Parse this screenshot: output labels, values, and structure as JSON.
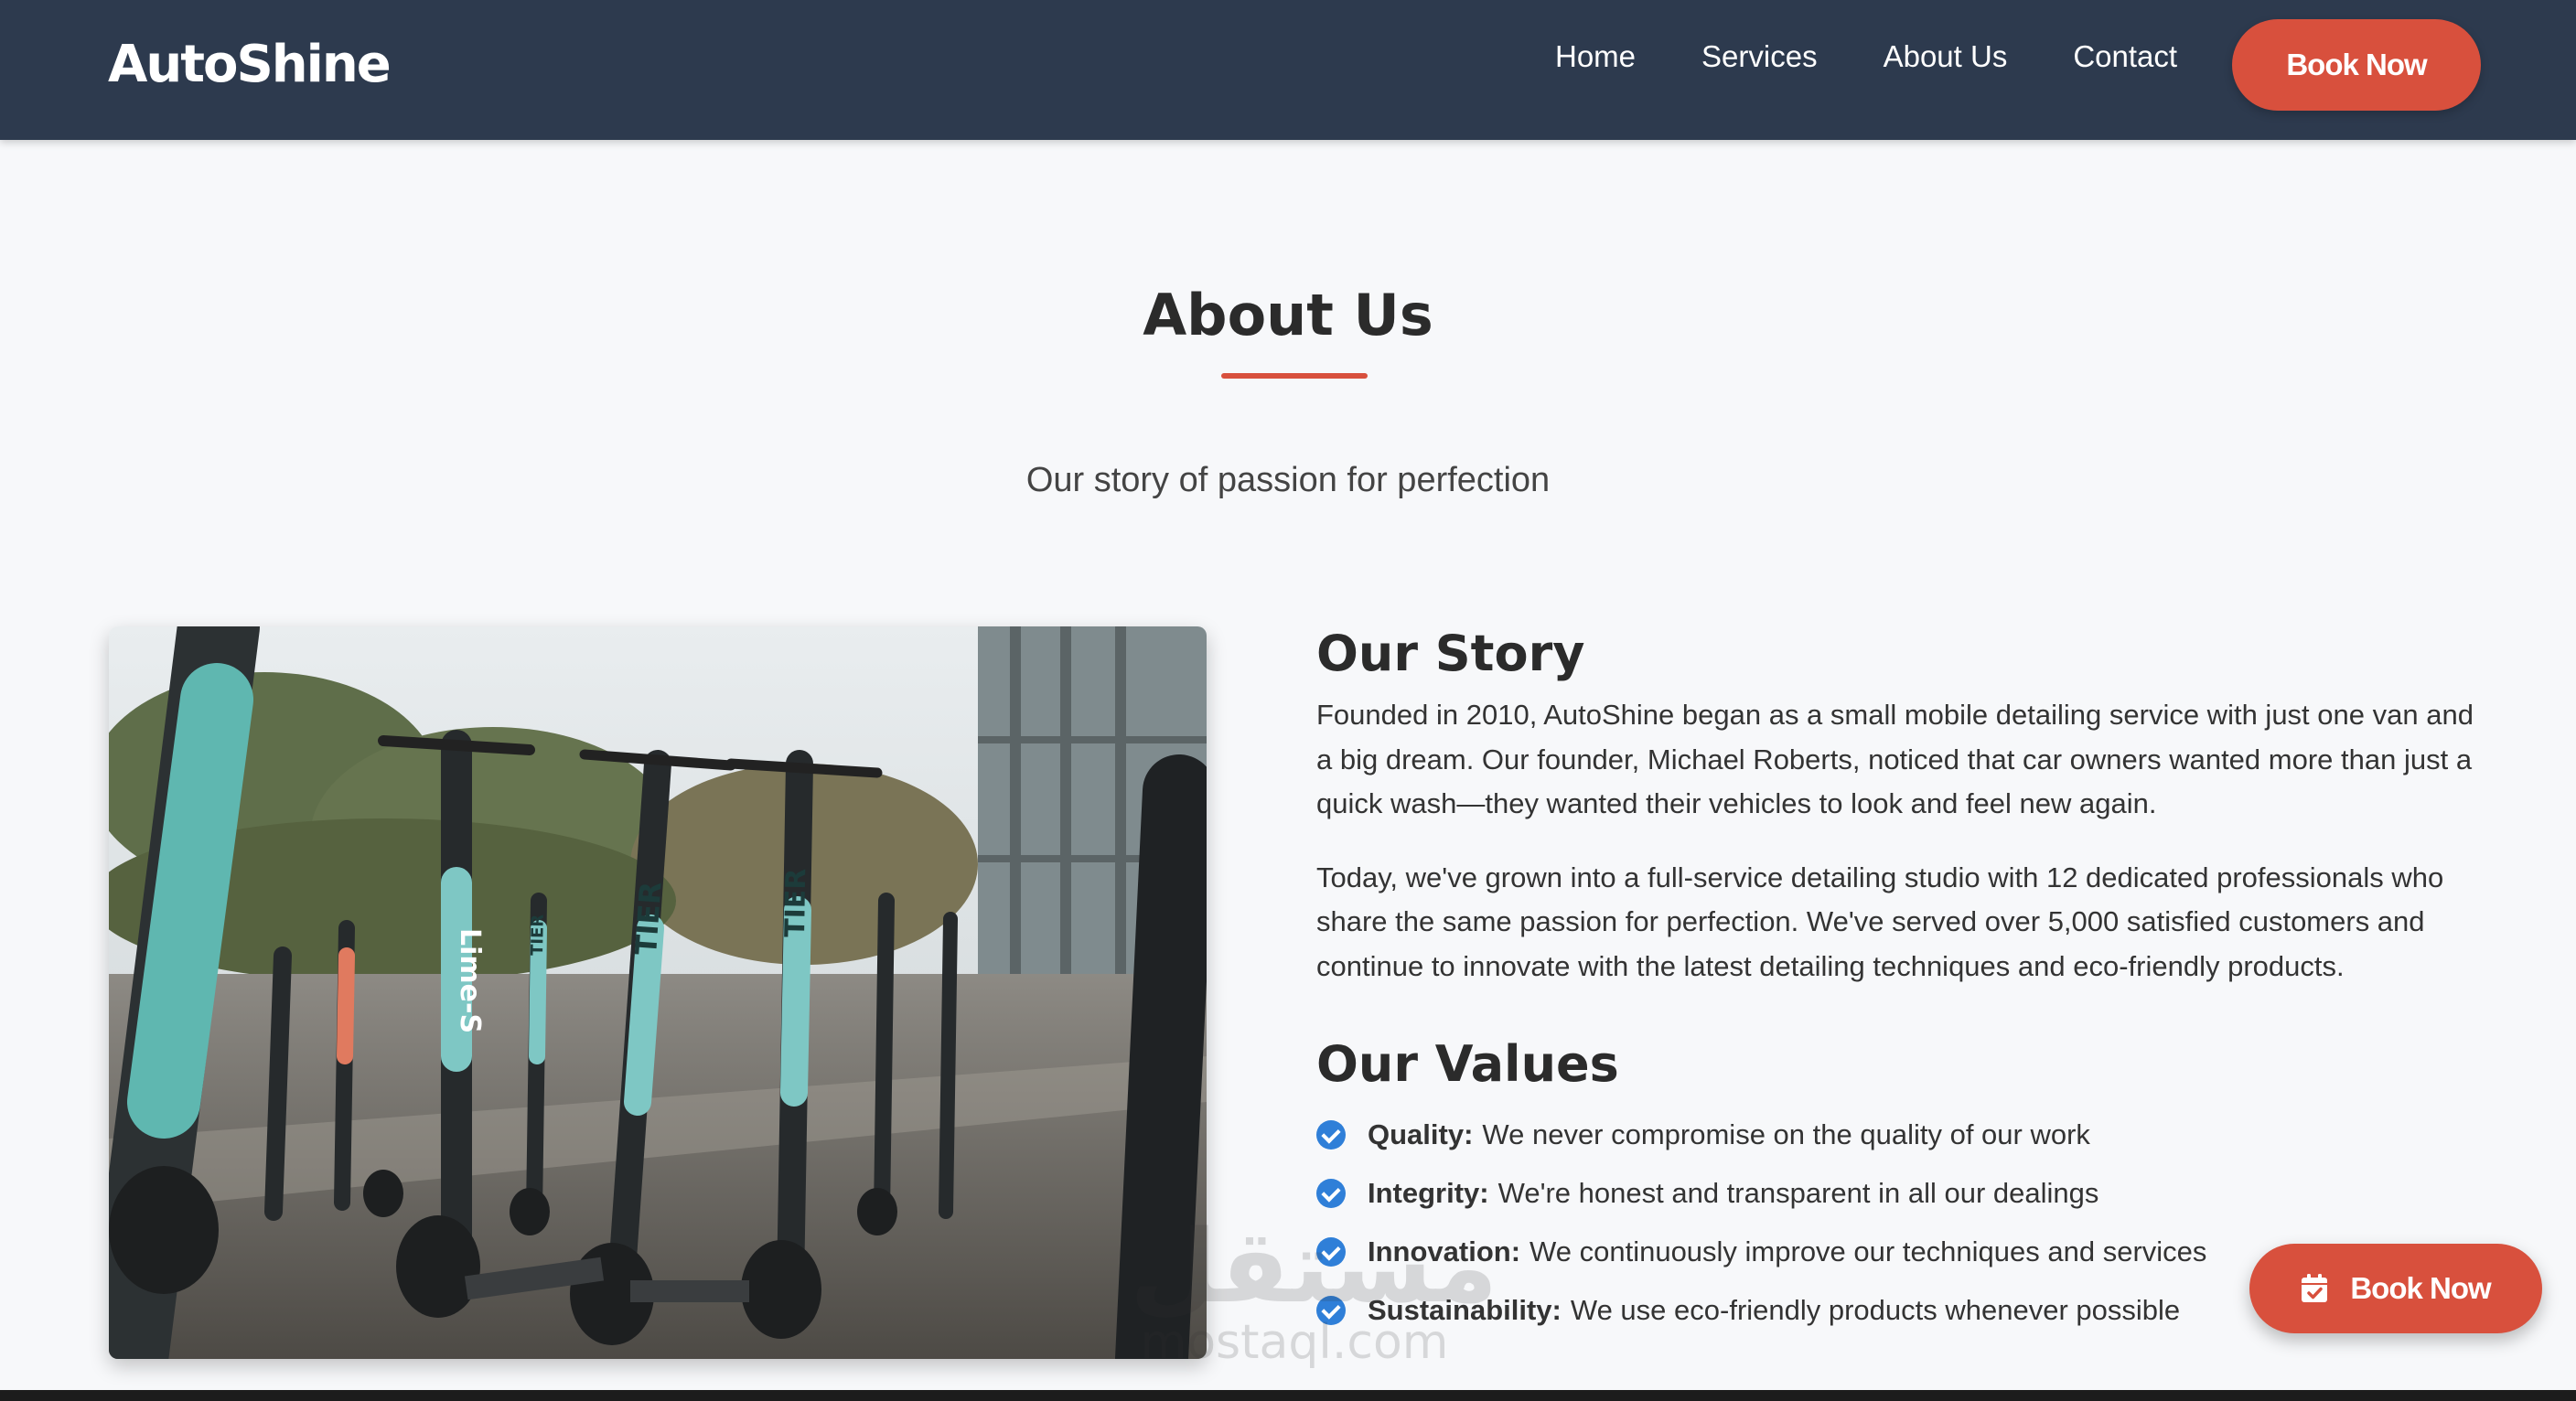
{
  "header": {
    "logo": "AutoShine",
    "nav": [
      "Home",
      "Services",
      "About Us",
      "Contact"
    ],
    "book_label": "Book Now"
  },
  "about": {
    "title": "About Us",
    "subtitle": "Our story of passion for perfection",
    "story_heading": "Our Story",
    "story_paragraphs": [
      "Founded in 2010, AutoShine began as a small mobile detailing service with just one van and a big dream. Our founder, Michael Roberts, noticed that car owners wanted more than just a quick wash—they wanted their vehicles to look and feel new again.",
      "Today, we've grown into a full-service detailing studio with 12 dedicated professionals who share the same passion for perfection. We've served over 5,000 satisfied customers and continue to innovate with the latest detailing techniques and eco-friendly products."
    ],
    "values_heading": "Our Values",
    "values": [
      {
        "name": "Quality:",
        "text": "We never compromise on the quality of our work"
      },
      {
        "name": "Integrity:",
        "text": "We're honest and transparent in all our dealings"
      },
      {
        "name": "Innovation:",
        "text": "We continuously improve our techniques and services"
      },
      {
        "name": "Sustainability:",
        "text": "We use eco-friendly products whenever possible"
      }
    ],
    "image_labels": [
      "Lime-S",
      "TIER",
      "TIER",
      "TIER"
    ]
  },
  "floating_button": {
    "label": "Book Now",
    "icon": "calendar-check-icon"
  },
  "watermark": {
    "arabic": "مستقل",
    "latin": "mostaql.com"
  },
  "colors": {
    "header_bg": "#2d3a4e",
    "accent": "#d8503d",
    "check": "#2f7fd8",
    "page_bg": "#f7f8fa"
  }
}
